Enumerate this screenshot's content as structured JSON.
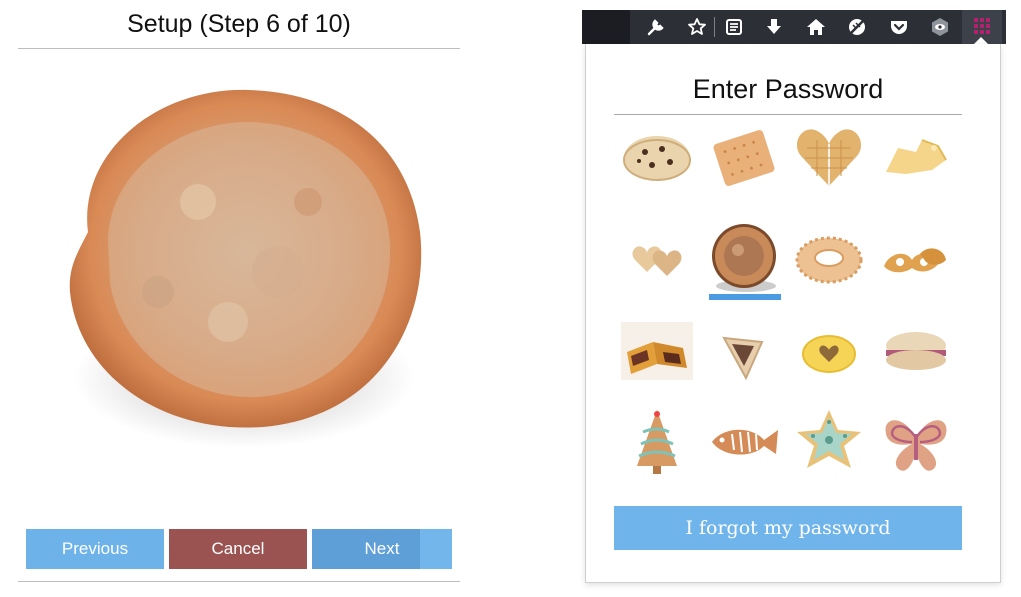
{
  "setup": {
    "title": "Setup (Step 6 of 10)",
    "image_alt": "orange sugar cookie",
    "buttons": {
      "previous": "Previous",
      "cancel": "Cancel",
      "next": "Next"
    }
  },
  "toolbar": {
    "icons": [
      "wrench-icon",
      "star-icon",
      "reader-icon",
      "download-icon",
      "home-icon",
      "no-tracking-icon",
      "pocket-icon",
      "eye-shield-icon",
      "grid-extension-icon"
    ]
  },
  "popup": {
    "title": "Enter Password",
    "forgot_label": "I forgot my password",
    "cookies": [
      "chocolate-chip-cookie",
      "square-biscuit",
      "heart-waffle-cookie",
      "butter-crisp",
      "small-hearts-cookie",
      "orange-sugar-cookie",
      "ring-cookie",
      "pretzel-cookies",
      "fig-bar",
      "hamantaschen",
      "heart-jam-cookie",
      "macaron",
      "tree-cookie",
      "fish-cookie",
      "star-cookie",
      "butterfly-cookie"
    ],
    "selected_index": 5
  },
  "colors": {
    "previous": "#6db3ea",
    "cancel": "#9b5352",
    "next": "#5e9fd8",
    "forgot": "#6fb4ea",
    "selection": "#4a9be2",
    "toolbar": "#2c2f36"
  }
}
